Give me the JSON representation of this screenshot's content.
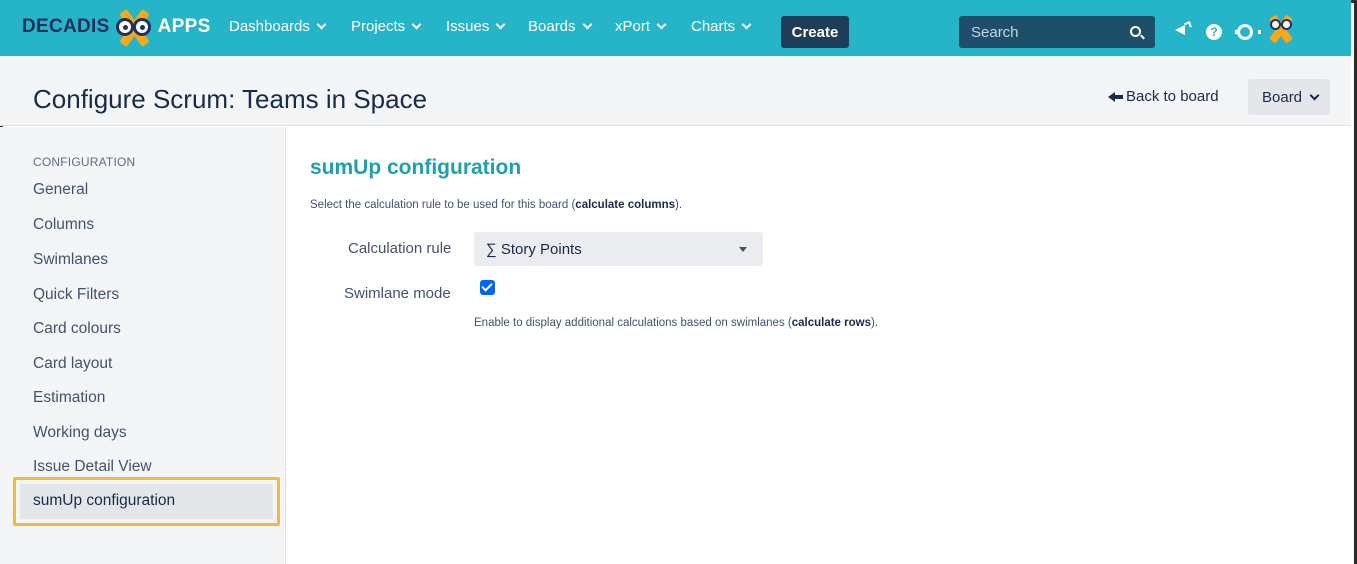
{
  "topnav": {
    "logo_left": "DECADIS",
    "logo_right": "APPS",
    "menu": [
      {
        "label": "Dashboards"
      },
      {
        "label": "Projects"
      },
      {
        "label": "Issues"
      },
      {
        "label": "Boards"
      },
      {
        "label": "xPort"
      },
      {
        "label": "Charts"
      }
    ],
    "create_label": "Create",
    "search_placeholder": "Search",
    "help_glyph": "?",
    "icons": [
      "search-icon",
      "megaphone-icon",
      "help-icon",
      "gear-icon",
      "avatar"
    ]
  },
  "header": {
    "title": "Configure Scrum: Teams in Space",
    "back_label": "Back to board",
    "board_label": "Board"
  },
  "sidebar": {
    "heading": "CONFIGURATION",
    "items": [
      {
        "label": "General"
      },
      {
        "label": "Columns"
      },
      {
        "label": "Swimlanes"
      },
      {
        "label": "Quick Filters"
      },
      {
        "label": "Card colours"
      },
      {
        "label": "Card layout"
      },
      {
        "label": "Estimation"
      },
      {
        "label": "Working days"
      },
      {
        "label": "Issue Detail View"
      }
    ],
    "active_item": "sumUp configuration"
  },
  "main": {
    "title": "sumUp configuration",
    "description_prefix": "Select the calculation rule to be used for this board (",
    "description_bold": "calculate columns",
    "description_suffix": ").",
    "calc_rule_label": "Calculation rule",
    "calc_rule_value": "∑ Story Points",
    "swimlane_label": "Swimlane mode",
    "swimlane_checked": true,
    "hint_prefix": "Enable to display additional calculations based on swimlanes (",
    "hint_bold": "calculate rows",
    "hint_suffix": ")."
  },
  "colors": {
    "topnav": "#26b5c8",
    "create": "#1d3d59",
    "accent_title": "#1f9fb0",
    "highlight": "#f5b942",
    "checkbox": "#0065ff"
  }
}
